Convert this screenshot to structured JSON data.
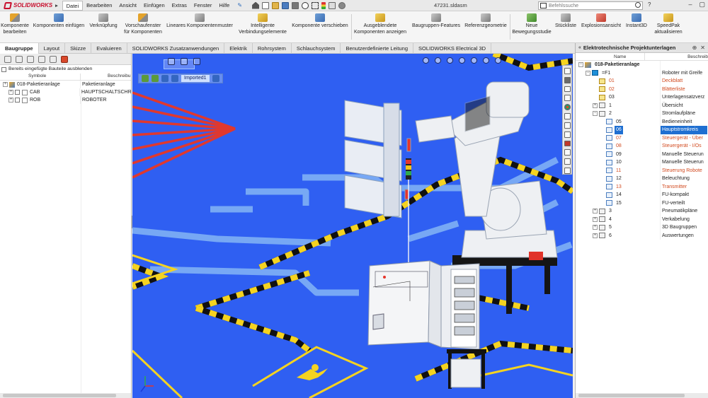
{
  "app": {
    "brand": "SOLIDWORKS",
    "filename": "47231.sldasm",
    "search_placeholder": "Befehlssuche"
  },
  "menu": [
    "Datei",
    "Bearbeiten",
    "Ansicht",
    "Einfügen",
    "Extras",
    "Fenster",
    "Hilfe"
  ],
  "ribbon": [
    {
      "label": "Komponente\nbearbeiten",
      "icon": "edit-component-icon"
    },
    {
      "label": "Komponenten einfügen",
      "icon": "insert-components-icon"
    },
    {
      "label": "Verknüpfung",
      "icon": "mate-icon"
    },
    {
      "label": "Vorschaufenster\nfür Komponenten",
      "icon": "component-preview-icon"
    },
    {
      "label": "Lineares Komponentenmuster",
      "icon": "linear-pattern-icon"
    },
    {
      "label": "Intelligente\nVerbindungselemente",
      "icon": "smart-fasteners-icon"
    },
    {
      "label": "Komponente verschieben",
      "icon": "move-component-icon"
    },
    {
      "label": "Ausgeblendete\nKomponenten anzeigen",
      "icon": "show-hidden-icon"
    },
    {
      "label": "Baugruppen-Features",
      "icon": "assembly-features-icon"
    },
    {
      "label": "Referenzgeometrie",
      "icon": "reference-geometry-icon"
    },
    {
      "label": "Neue\nBewegungsstudie",
      "icon": "motion-study-icon"
    },
    {
      "label": "Stückliste",
      "icon": "bom-icon"
    },
    {
      "label": "Explosionsansicht",
      "icon": "exploded-view-icon"
    },
    {
      "label": "Instant3D",
      "icon": "instant3d-icon"
    },
    {
      "label": "SpeedPak\naktualisieren",
      "icon": "speedpak-icon"
    }
  ],
  "tabs": [
    "Baugruppe",
    "Layout",
    "Skizze",
    "Evaluieren",
    "SOLIDWORKS Zusatzanwendungen",
    "Elektrik",
    "Rohrsystem",
    "Schlauchsystem",
    "Benutzerdefinierte Leitung",
    "SOLIDWORKS Electrical 3D"
  ],
  "left_panel": {
    "hide_checkbox_label": "Bereits eingefügte Bauteile ausblenden",
    "col_symbol": "Symbole",
    "col_desc": "Beschreibu",
    "rows": [
      {
        "name": "018-Paketieranlage",
        "desc": "Paketieranlage"
      },
      {
        "name": "CAB",
        "desc": "HAUPTSCHALTSCHR"
      },
      {
        "name": "ROB",
        "desc": "ROBOTER"
      }
    ]
  },
  "viewport": {
    "imported_label": "Imported1"
  },
  "right_panel": {
    "title": "Elektrotechnische Projektunterlagen",
    "col_name": "Name",
    "col_desc": "Beschreib",
    "rows": [
      {
        "name": "018-Paketieranlage",
        "desc": "",
        "level": 0,
        "icon": "proj",
        "exp": "−",
        "bold": true
      },
      {
        "name": "=F1",
        "desc": "Roboter mit Greife",
        "level": 1,
        "icon": "f1",
        "exp": "−"
      },
      {
        "name": "01",
        "desc": "Deckblatt",
        "level": 2,
        "icon": "pagey",
        "exp": "",
        "red": true
      },
      {
        "name": "02",
        "desc": "Blätterliste",
        "level": 2,
        "icon": "pagey",
        "exp": "",
        "red": true
      },
      {
        "name": "03",
        "desc": "Unterlagensatzverz",
        "level": 2,
        "icon": "pagey",
        "exp": ""
      },
      {
        "name": "1",
        "desc": "Übersicht",
        "level": 2,
        "icon": "folder",
        "exp": "+"
      },
      {
        "name": "2",
        "desc": "Stromlaufpläne",
        "level": 2,
        "icon": "folder",
        "exp": "−"
      },
      {
        "name": "05",
        "desc": "Bedieneinheit",
        "level": 3,
        "icon": "page",
        "exp": ""
      },
      {
        "name": "06",
        "desc": "Hauptstromkreis",
        "level": 3,
        "icon": "page",
        "exp": "",
        "sel": true
      },
      {
        "name": "07",
        "desc": "Steuergerät - Über",
        "level": 3,
        "icon": "page",
        "exp": "",
        "red": true
      },
      {
        "name": "08",
        "desc": "Steuergerät - I/Os",
        "level": 3,
        "icon": "page",
        "exp": "",
        "red": true
      },
      {
        "name": "09",
        "desc": "Manuelle Steuerun",
        "level": 3,
        "icon": "page",
        "exp": ""
      },
      {
        "name": "10",
        "desc": "Manuelle Steuerun",
        "level": 3,
        "icon": "page",
        "exp": ""
      },
      {
        "name": "11",
        "desc": "Steuerung Robote",
        "level": 3,
        "icon": "page",
        "exp": "",
        "red": true
      },
      {
        "name": "12",
        "desc": "Beleuchtung",
        "level": 3,
        "icon": "page",
        "exp": ""
      },
      {
        "name": "13",
        "desc": "Transmitter",
        "level": 3,
        "icon": "page",
        "exp": "",
        "red": true
      },
      {
        "name": "14",
        "desc": "FU-kompakt",
        "level": 3,
        "icon": "page",
        "exp": ""
      },
      {
        "name": "15",
        "desc": "FU-verteilt",
        "level": 3,
        "icon": "page",
        "exp": ""
      },
      {
        "name": "3",
        "desc": "Pneumatikpläne",
        "level": 2,
        "icon": "folder",
        "exp": "+"
      },
      {
        "name": "4",
        "desc": "Verkabelung",
        "level": 2,
        "icon": "folder",
        "exp": "+"
      },
      {
        "name": "5",
        "desc": "3D Baugruppen",
        "level": 2,
        "icon": "folder",
        "exp": "+"
      },
      {
        "name": "6",
        "desc": "Auswertungen",
        "level": 2,
        "icon": "folder",
        "exp": "+"
      }
    ]
  },
  "colors": {
    "viewport_bg": "#2f5ff2",
    "accent_red": "#c8102e",
    "selection": "#1f6fd1",
    "warning_text": "#d24a1f"
  }
}
